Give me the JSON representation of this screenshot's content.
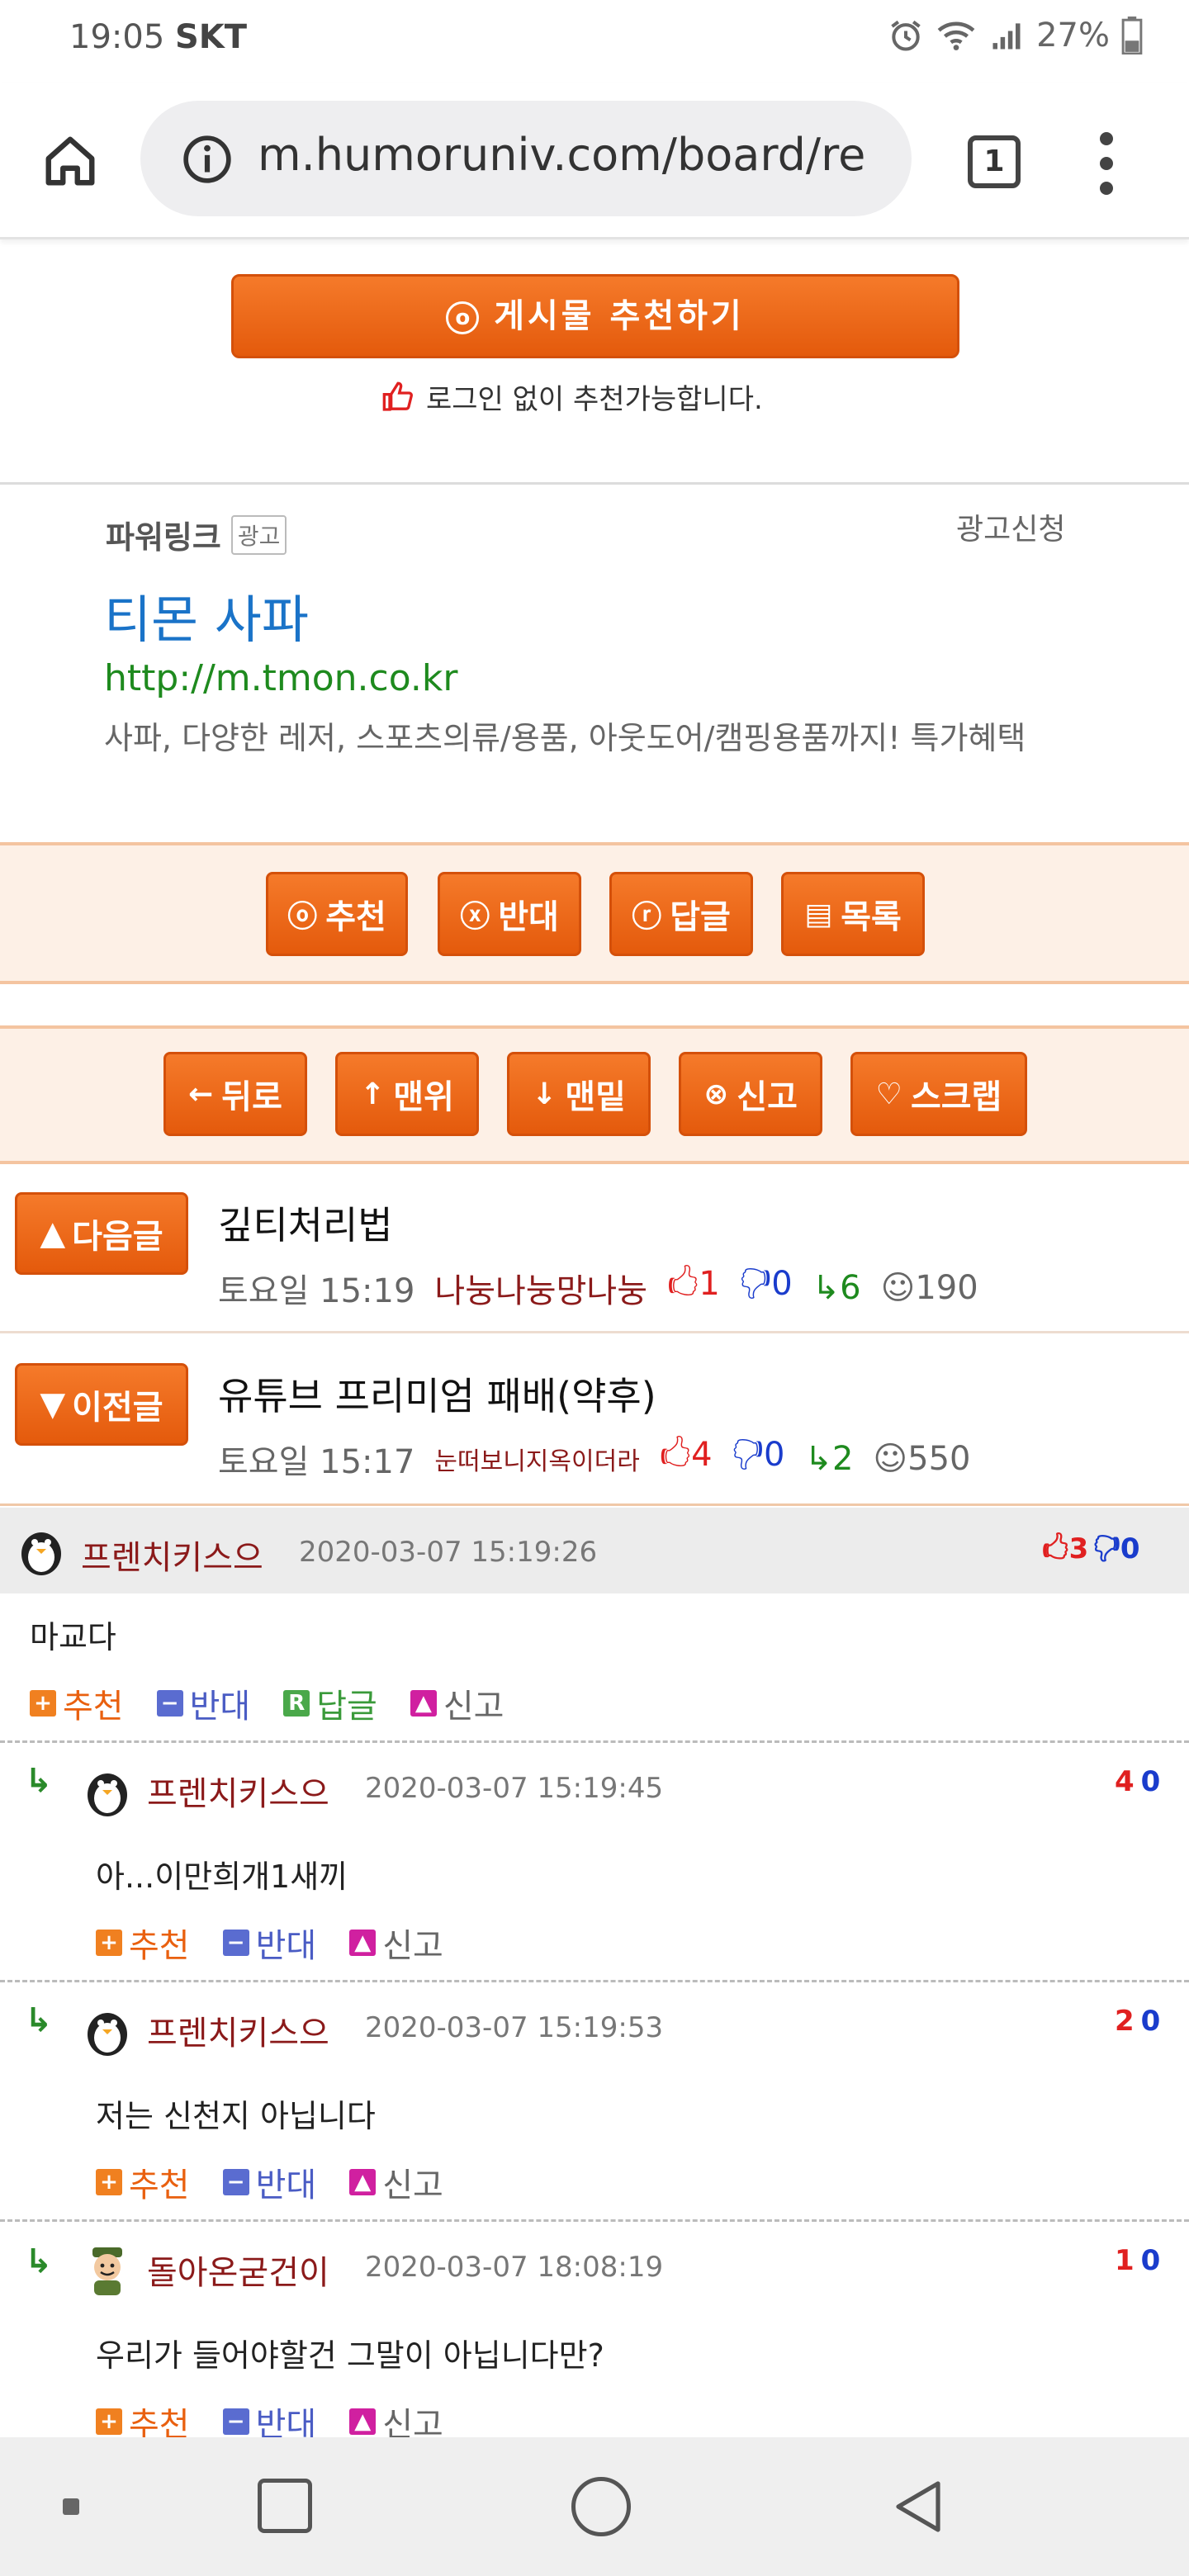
{
  "status_bar": {
    "time": "19:05",
    "carrier": "SKT",
    "battery": "27%"
  },
  "browser": {
    "url": "m.humoruniv.com/board/re",
    "tab_count": "1"
  },
  "recommend": {
    "button_label": "게시물  추천하기",
    "note": "로그인 없이 추천가능합니다."
  },
  "ad": {
    "label": "파워링크",
    "badge": "광고",
    "apply": "광고신청",
    "title": "티몬 사파",
    "url": "http://m.tmon.co.kr",
    "description": "사파, 다양한 레저, 스포츠의류/용품, 아웃도어/캠핑용품까지! 특가혜택"
  },
  "actions": {
    "recommend": "추천",
    "oppose": "반대",
    "reply": "답글",
    "list": "목록"
  },
  "nav_buttons": {
    "back": "뒤로",
    "top": "맨위",
    "bottom": "맨밑",
    "report": "신고",
    "scrap": "스크랩"
  },
  "next_post": {
    "label": "다음글",
    "title": "깊티처리법",
    "time": "토요일 15:19",
    "author": "나눙나눙망나눙",
    "up": "1",
    "down": "0",
    "replies": "6",
    "views": "190"
  },
  "prev_post": {
    "label": "이전글",
    "title": "유튜브 프리미엄 패배(약후)",
    "time": "토요일 15:17",
    "author": "눈떠보니지옥이더라",
    "up": "4",
    "down": "0",
    "replies": "2",
    "views": "550"
  },
  "comment_actions": {
    "recommend": "추천",
    "oppose": "반대",
    "reply": "답글",
    "report": "신고"
  },
  "comments": [
    {
      "nick": "프렌치키스으",
      "date": "2020-03-07 15:19:26",
      "up": "3",
      "down": "0",
      "text": "마교다"
    },
    {
      "nick": "프렌치키스으",
      "date": "2020-03-07 15:19:45",
      "up": "4",
      "down": "0",
      "text": "아...이만희개1새끼"
    },
    {
      "nick": "프렌치키스으",
      "date": "2020-03-07 15:19:53",
      "up": "2",
      "down": "0",
      "text": "저는 신천지 아닙니다"
    },
    {
      "nick": "돌아온굳건이",
      "date": "2020-03-07 18:08:19",
      "up": "1",
      "down": "0",
      "text": "우리가 들어야할건 그말이 아닙니다만?"
    }
  ],
  "colors": {
    "accent": "#e9600f",
    "nick": "#8b1a1a",
    "up": "#e02020",
    "down": "#1a3ccc",
    "reply": "#1e8a1e"
  }
}
